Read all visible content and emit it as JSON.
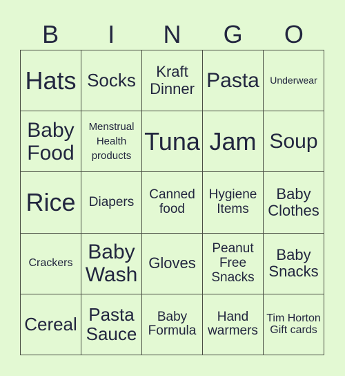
{
  "header": {
    "letters": [
      "B",
      "I",
      "N",
      "G",
      "O"
    ]
  },
  "colors": {
    "background": "#e3f9d3",
    "text": "#22263f",
    "grid_line": "#4a4f44"
  },
  "board": {
    "rows": [
      [
        "Hats",
        "Socks",
        "Kraft Dinner",
        "Pasta",
        "Underwear"
      ],
      [
        "Baby Food",
        "Menstrual Health products",
        "Tuna",
        "Jam",
        "Soup"
      ],
      [
        "Rice",
        "Diapers",
        "Canned food",
        "Hygiene Items",
        "Baby Clothes"
      ],
      [
        "Crackers",
        "Baby Wash",
        "Gloves",
        "Peanut Free Snacks",
        "Baby Snacks"
      ],
      [
        "Cereal",
        "Pasta Sauce",
        "Baby Formula",
        "Hand warmers",
        "Tim Horton Gift cards"
      ]
    ]
  }
}
